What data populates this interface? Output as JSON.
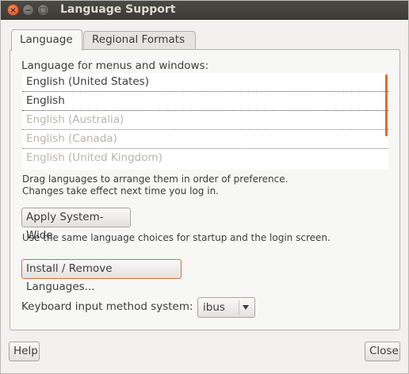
{
  "window": {
    "title": "Language Support",
    "close_glyph": "×",
    "minimize_glyph": "−",
    "maximize_glyph": "□"
  },
  "tabs": [
    {
      "label": "Language",
      "active": true
    },
    {
      "label": "Regional Formats",
      "active": false
    }
  ],
  "language_tab": {
    "list_label": "Language for menus and windows:",
    "languages": [
      {
        "name": "English (United States)",
        "enabled": true
      },
      {
        "name": "English",
        "enabled": true
      },
      {
        "name": "English (Australia)",
        "enabled": false
      },
      {
        "name": "English (Canada)",
        "enabled": false
      },
      {
        "name": "English (United Kingdom)",
        "enabled": false
      }
    ],
    "hint_line1": "Drag languages to arrange them in order of preference.",
    "hint_line2": "Changes take effect next time you log in.",
    "apply_button": "Apply System-Wide",
    "apply_hint": "Use the same language choices for startup and the login screen.",
    "install_button": "Install / Remove Languages...",
    "keyboard_label": "Keyboard input method system:",
    "keyboard_value": "ibus"
  },
  "footer": {
    "help_button": "Help",
    "close_button": "Close"
  },
  "colors": {
    "accent": "#e06a2a",
    "titlebar": "#3c3b37"
  }
}
